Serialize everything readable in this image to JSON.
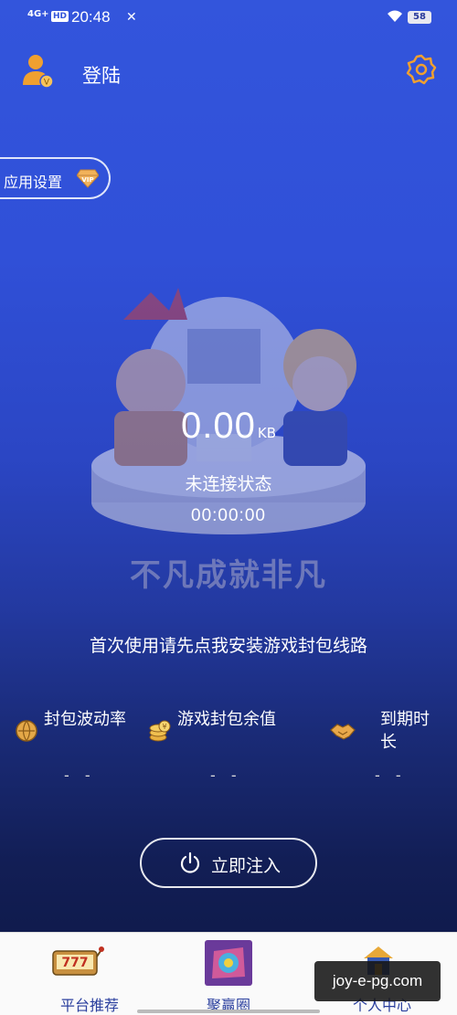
{
  "status_bar": {
    "signal": "4G+",
    "hd": "HD",
    "time": "20:48",
    "battery": "58"
  },
  "header": {
    "login_label": "登陆"
  },
  "app_settings": {
    "label": "应用设置"
  },
  "hero": {
    "speed_value": "0.00",
    "speed_unit": "KB",
    "connection_status": "未连接状态",
    "timer": "00:00:00",
    "slogan": "不凡成就非凡"
  },
  "notice": "首次使用请先点我安装游戏封包线路",
  "stats": [
    {
      "label": "封包波动率",
      "value": "- -"
    },
    {
      "label": "游戏封包余值",
      "value": "- -"
    },
    {
      "label": "到期时长",
      "value": "- -"
    }
  ],
  "inject_button": {
    "label": "立即注入"
  },
  "bottom_nav": [
    {
      "label": "平台推荐"
    },
    {
      "label": "聚赢圈"
    },
    {
      "label": "个人中心"
    }
  ],
  "watermark": "joy-e-pg.com",
  "colors": {
    "accent": "#3355dc",
    "nav_text": "#2a3f9e",
    "avatar_orange": "#f0a030"
  }
}
